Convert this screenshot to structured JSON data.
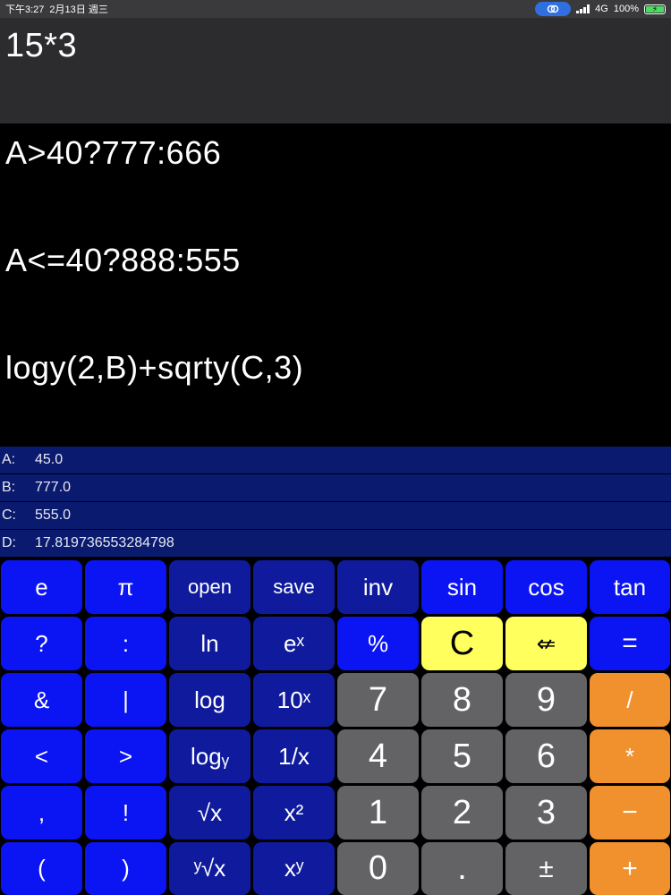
{
  "status": {
    "time": "下午3:27",
    "date": "2月13日 週三",
    "network": "4G",
    "battery": "100%"
  },
  "input": "15*3",
  "expressions": [
    "A>40?777:666",
    "A<=40?888:555",
    "logy(2,B)+sqrty(C,3)"
  ],
  "variables": [
    {
      "name": "A:",
      "value": "45.0"
    },
    {
      "name": "B:",
      "value": "777.0"
    },
    {
      "name": "C:",
      "value": "555.0"
    },
    {
      "name": "D:",
      "value": "17.819736553284798"
    }
  ],
  "keys": [
    [
      "e",
      "π",
      "open",
      "save",
      "inv",
      "sin",
      "cos",
      "tan"
    ],
    [
      "?",
      ":",
      "ln",
      "eˣ",
      "%",
      "C",
      "⇍",
      "="
    ],
    [
      "&",
      "|",
      "log",
      "10ˣ",
      "7",
      "8",
      "9",
      "/"
    ],
    [
      "<",
      ">",
      "logᵧ",
      "1/x",
      "4",
      "5",
      "6",
      "*"
    ],
    [
      ",",
      "!",
      "√x",
      "x²",
      "1",
      "2",
      "3",
      "−"
    ],
    [
      "(",
      ")",
      "ʸ√x",
      "xʸ",
      "0",
      ".",
      "±",
      "+"
    ]
  ],
  "colors": {
    "key_blue": "#0b14f2",
    "key_navy": "#0f1b9c",
    "key_gray": "#636366",
    "key_orange": "#f0912e",
    "key_yellow": "#ffff5e",
    "variable_row": "#0a1a6e"
  }
}
